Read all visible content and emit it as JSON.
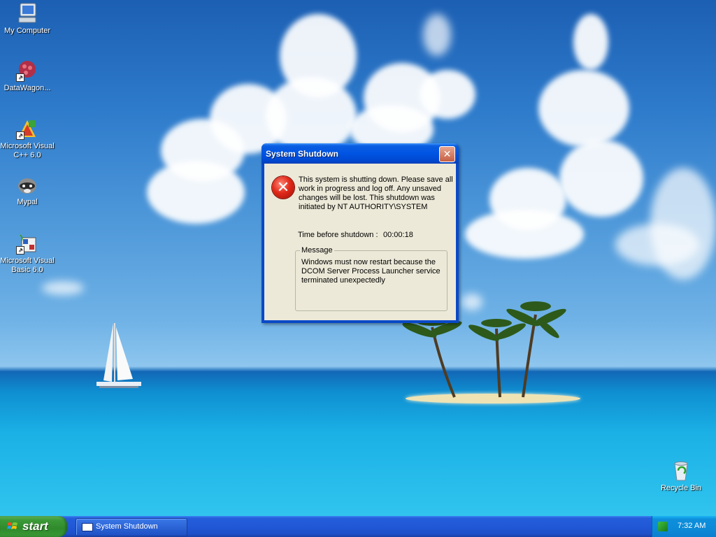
{
  "desktop": {
    "icons": [
      {
        "label": "My Computer",
        "icon": "my-computer-icon"
      },
      {
        "label": "DataWagon...",
        "icon": "datawagon-icon"
      },
      {
        "label": "Microsoft Visual C++ 6.0",
        "icon": "visual-cpp-icon"
      },
      {
        "label": "Mypal",
        "icon": "mypal-raccoon-icon"
      },
      {
        "label": "Microsoft Visual Basic 6.0",
        "icon": "visual-basic-icon"
      },
      {
        "label": "Recycle Bin",
        "icon": "recycle-bin-icon"
      }
    ]
  },
  "dialog": {
    "title": "System Shutdown",
    "close_glyph": "✕",
    "icon": "error-icon",
    "message": "This system is shutting down. Please save all work in progress and log off. Any unsaved changes will be lost. This shutdown was initiated by NT AUTHORITY\\SYSTEM",
    "time_label": "Time before shutdown :",
    "time_value": "00:00:18",
    "group_label": "Message",
    "group_text": "Windows must now restart because the DCOM Server Process Launcher service terminated unexpectedly"
  },
  "taskbar": {
    "start_label": "start",
    "tasks": [
      {
        "label": "System Shutdown"
      }
    ],
    "clock": "7:32 AM"
  },
  "colors": {
    "titlebar": "#0054e3",
    "dialog_face": "#ece9d8",
    "start_green": "#3c9a37",
    "taskbar_blue": "#245edb",
    "error_red": "#e12a1a"
  }
}
